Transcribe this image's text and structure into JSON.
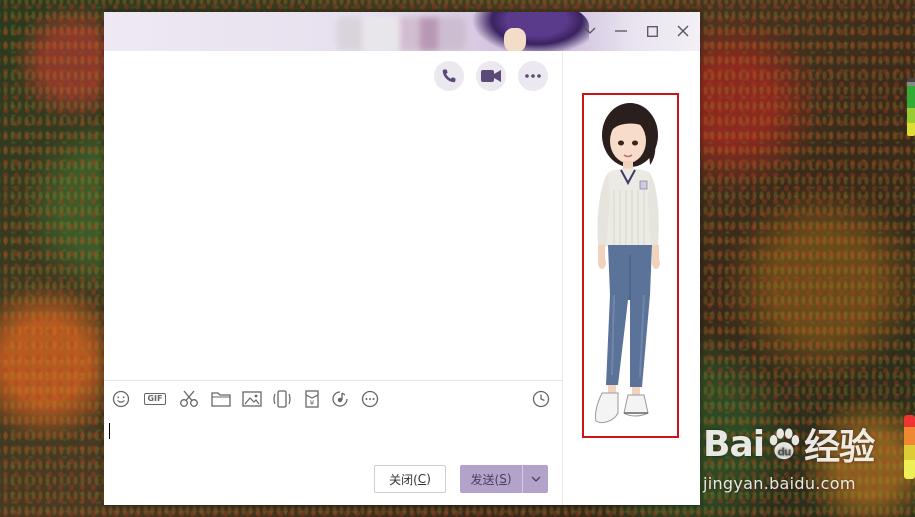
{
  "window": {
    "controls": [
      "chevron-down-icon",
      "minimize-icon",
      "maximize-icon",
      "close-icon"
    ]
  },
  "call_actions": [
    "phone-icon",
    "video-camera-icon",
    "more-dots-icon"
  ],
  "toolbar": {
    "gif_label": "GIF",
    "tools": [
      "emoji-icon",
      "gif-icon",
      "scissors-icon",
      "folder-icon",
      "image-icon",
      "shake-icon",
      "red-envelope-icon",
      "music-icon",
      "more-icon",
      "history-clock-icon"
    ]
  },
  "buttons": {
    "close_label": "关闭(",
    "close_key": "C",
    "close_suffix": ")",
    "send_label": "发送(",
    "send_key": "S",
    "send_suffix": ")"
  },
  "colors": {
    "accent": "#b3a3cb",
    "highlight_frame": "#d0121b"
  },
  "watermark": {
    "brand_left": "Bai",
    "brand_right": "经验",
    "url": "jingyan.baidu.com"
  }
}
